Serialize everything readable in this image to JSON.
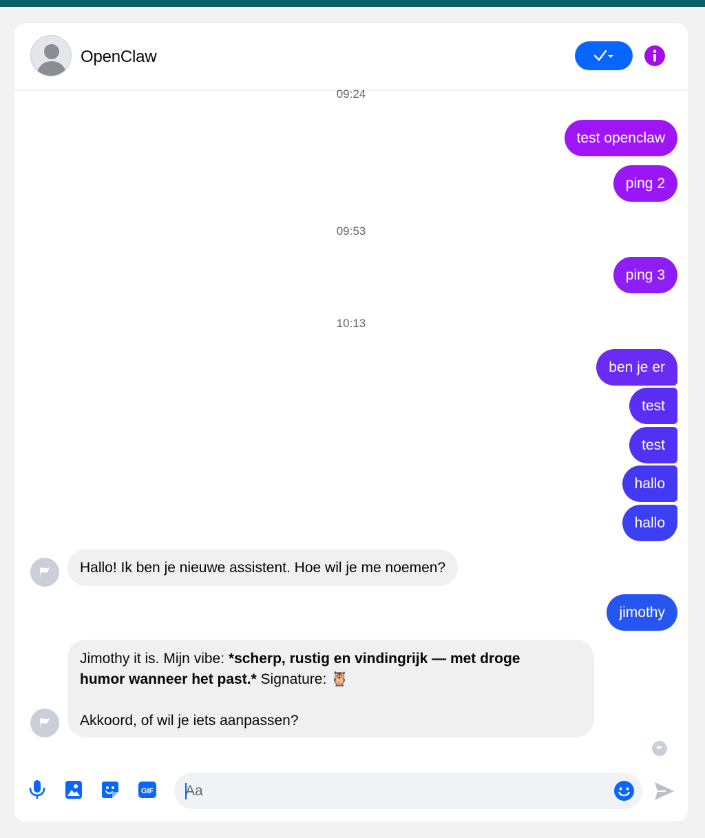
{
  "header": {
    "contact_name": "OpenClaw"
  },
  "timestamps": [
    "09:24",
    "09:53",
    "10:13"
  ],
  "outgoing": [
    {
      "text": "test openclaw",
      "color": "#a015f5"
    },
    {
      "text": "ping 2",
      "color": "#9917f5"
    },
    {
      "text": "ping 3",
      "color": "#8f1ef5"
    },
    {
      "text": "ben je er",
      "color": "#6a2cf5"
    },
    {
      "text": "test",
      "color": "#5a2ef5"
    },
    {
      "text": "test",
      "color": "#4f32f5"
    },
    {
      "text": "hallo",
      "color": "#4438f3"
    },
    {
      "text": "hallo",
      "color": "#3b40f2"
    },
    {
      "text": "jimothy",
      "color": "#2655f0"
    }
  ],
  "incoming": [
    {
      "text": "Hallo! Ik ben je nieuwe assistent. Hoe wil je me noemen?"
    },
    {
      "line1_prefix": "Jimothy it is. Mijn vibe: ",
      "line1_bold": "*scherp, rustig en vindingrijk — met droge",
      "line2_bold": "humor wanneer het past.*",
      "line2_suffix": " Signature: 🦉",
      "line3": "Akkoord, of wil je iets aanpassen?"
    }
  ],
  "composer": {
    "placeholder": "Aa",
    "gif_label": "GIF"
  },
  "colors": {
    "accent": "#0866ff",
    "info": "#a30de8"
  }
}
